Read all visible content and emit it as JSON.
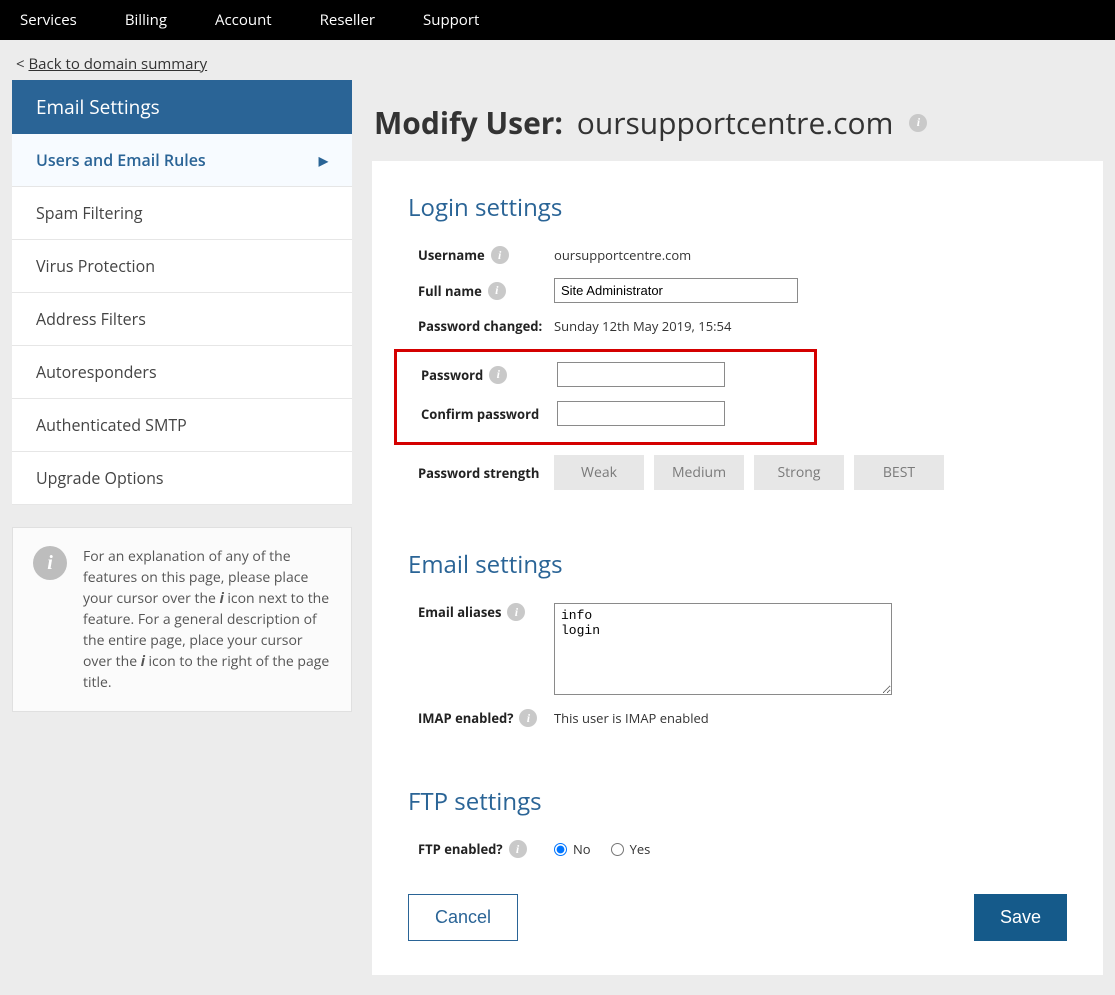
{
  "topnav": [
    "Services",
    "Billing",
    "Account",
    "Reseller",
    "Support"
  ],
  "back_prefix": "< ",
  "back_label": "Back to domain summary",
  "sidebar": {
    "header": "Email Settings",
    "items": [
      "Users and Email Rules",
      "Spam Filtering",
      "Virus Protection",
      "Address Filters",
      "Autoresponders",
      "Authenticated SMTP",
      "Upgrade Options"
    ]
  },
  "infobox_pre": "For an explanation of any of the features on this page, please place your cursor over the ",
  "infobox_mid": " icon next to the feature. For a general description of the entire page, place your cursor over the ",
  "infobox_post": " icon to the right of the page title.",
  "infobox_i": "i",
  "page_title_prefix": "Modify User:",
  "page_title_domain": "oursupportcentre.com",
  "section_login": "Login settings",
  "labels": {
    "username": "Username",
    "full_name": "Full name",
    "pw_changed": "Password changed:",
    "password": "Password",
    "confirm_pw": "Confirm password",
    "pw_strength": "Password strength",
    "email_aliases": "Email aliases",
    "imap_enabled": "IMAP enabled?",
    "ftp_enabled": "FTP enabled?"
  },
  "values": {
    "username": "oursupportcentre.com",
    "full_name": "Site Administrator",
    "pw_changed": "Sunday 12th May 2019, 15:54",
    "email_aliases": "info\nlogin",
    "imap_status": "This user is IMAP enabled"
  },
  "strength": [
    "Weak",
    "Medium",
    "Strong",
    "BEST"
  ],
  "section_email": "Email settings",
  "section_ftp": "FTP settings",
  "radio_no": "No",
  "radio_yes": "Yes",
  "btn_cancel": "Cancel",
  "btn_save": "Save"
}
